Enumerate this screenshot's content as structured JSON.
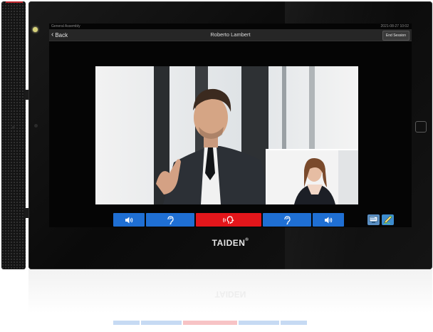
{
  "device": {
    "brand": "TAIDEN",
    "brand_mark": "®",
    "colors": {
      "accent": "#c0262d",
      "toolbar_blue": "#1f6fd3",
      "toolbar_red": "#e3161b"
    }
  },
  "statusbar": {
    "meeting_name": "General Assembly",
    "datetime": "2021-08-27 10:02"
  },
  "topbar": {
    "back_label": "Back",
    "back_icon": "chevron-left-icon",
    "title": "Roberto Lambert",
    "end_button_label": "End Session"
  },
  "toolbar": {
    "buttons": [
      {
        "name": "volume-down",
        "icon": "speaker-icon",
        "color": "blue"
      },
      {
        "name": "listen-left",
        "icon": "ear-icon",
        "color": "blue"
      },
      {
        "name": "speak",
        "icon": "speaking-head-icon",
        "color": "red"
      },
      {
        "name": "listen-right",
        "icon": "ear-icon",
        "color": "blue"
      },
      {
        "name": "volume-up",
        "icon": "speaker-icon",
        "color": "blue"
      }
    ],
    "side_icons": [
      "screen-share-icon",
      "pen-icon"
    ]
  }
}
